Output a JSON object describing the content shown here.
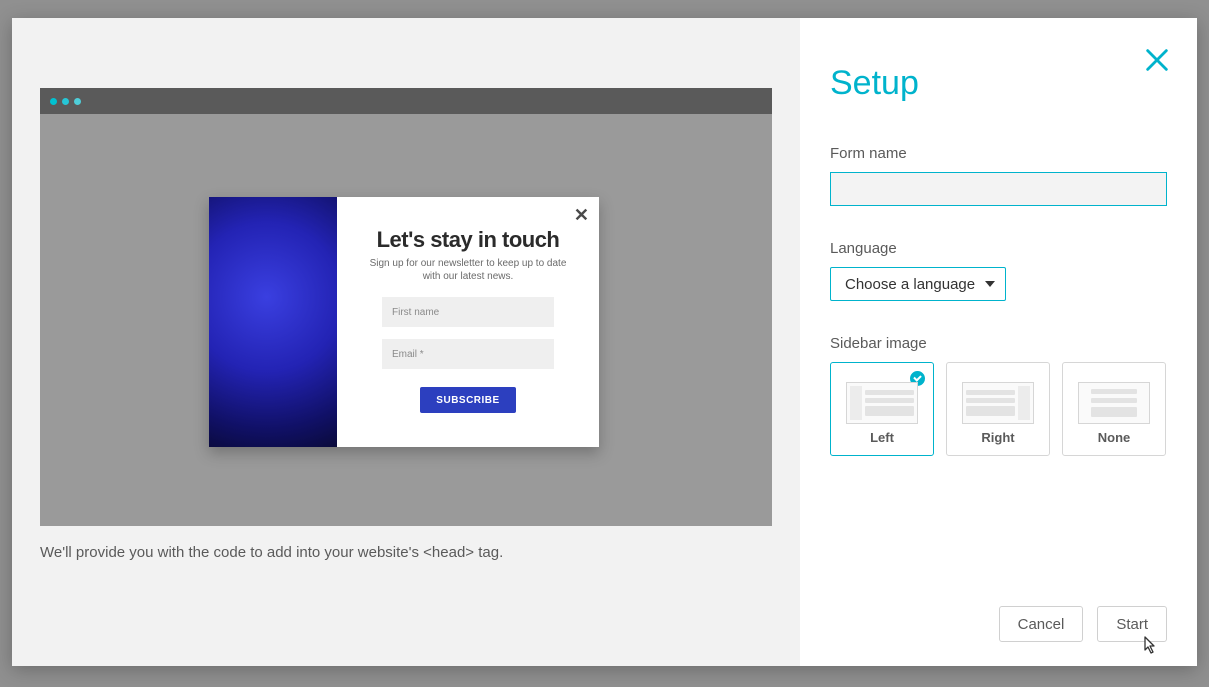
{
  "setup": {
    "title": "Setup",
    "form_name_label": "Form name",
    "form_name_value": "",
    "language_label": "Language",
    "language_value": "Choose a language",
    "sidebar_label": "Sidebar image",
    "options": {
      "left": "Left",
      "right": "Right",
      "none": "None"
    },
    "cancel": "Cancel",
    "start": "Start"
  },
  "preview": {
    "title": "Let's stay in touch",
    "subtitle": "Sign up for our newsletter to keep up to date with our latest news.",
    "first_name_placeholder": "First name",
    "email_placeholder": "Email *",
    "subscribe": "SUBSCRIBE",
    "helper": "We'll provide you with the code to add into your website's <head> tag."
  }
}
